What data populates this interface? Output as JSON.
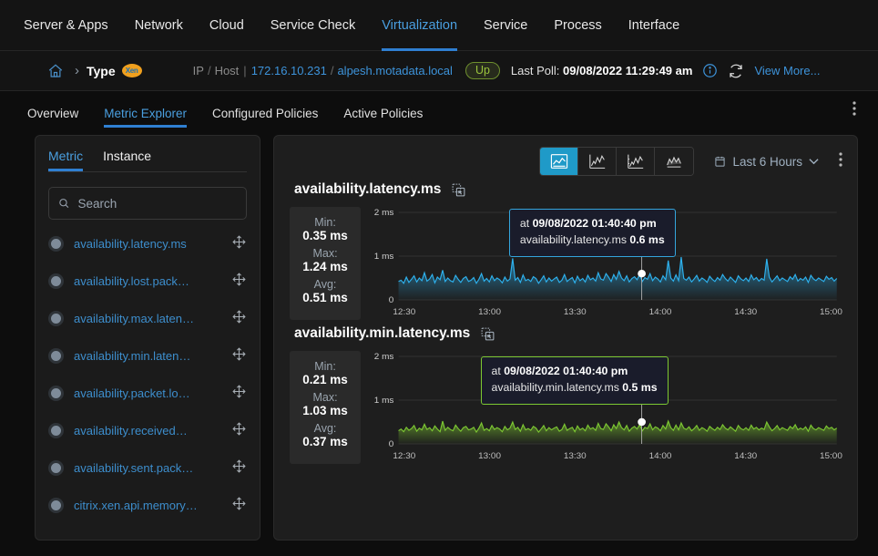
{
  "topnav": {
    "items": [
      {
        "label": "Server & Apps",
        "active": false
      },
      {
        "label": "Network",
        "active": false
      },
      {
        "label": "Cloud",
        "active": false
      },
      {
        "label": "Service Check",
        "active": false
      },
      {
        "label": "Virtualization",
        "active": true
      },
      {
        "label": "Service",
        "active": false
      },
      {
        "label": "Process",
        "active": false
      },
      {
        "label": "Interface",
        "active": false
      }
    ]
  },
  "breadcrumb": {
    "home_icon": "home-icon",
    "chevron": "›",
    "type_label": "Type",
    "vendor_logo": "Xen",
    "ip_label": "IP",
    "host_label": "Host",
    "ip_value": "172.16.10.231",
    "host_value": "alpesh.motadata.local",
    "separator": "/",
    "pipe": "|",
    "status": "Up",
    "last_poll_label": "Last Poll:",
    "last_poll_value": "09/08/2022 11:29:49 am",
    "view_more": "View More...",
    "accent_color": "#3d93da",
    "status_color": "#9bc53d"
  },
  "subtabs": {
    "items": [
      {
        "label": "Overview",
        "active": false
      },
      {
        "label": "Metric Explorer",
        "active": true
      },
      {
        "label": "Configured Policies",
        "active": false
      },
      {
        "label": "Active Policies",
        "active": false
      }
    ]
  },
  "sidebar": {
    "tabs": [
      {
        "label": "Metric",
        "active": true
      },
      {
        "label": "Instance",
        "active": false
      }
    ],
    "search": {
      "placeholder": "Search",
      "value": ""
    },
    "metrics": [
      {
        "label": "availability.latency.ms"
      },
      {
        "label": "availability.lost.pack…"
      },
      {
        "label": "availability.max.laten…"
      },
      {
        "label": "availability.min.laten…"
      },
      {
        "label": "availability.packet.lo…"
      },
      {
        "label": "availability.received…"
      },
      {
        "label": "availability.sent.pack…"
      },
      {
        "label": "citrix.xen.api.memory…"
      }
    ]
  },
  "toolbar": {
    "view_buttons": [
      {
        "icon": "area-chart-icon",
        "active": true
      },
      {
        "icon": "line-chart-icon",
        "active": false
      },
      {
        "icon": "line-chart-scale-icon",
        "active": false
      },
      {
        "icon": "stacked-area-chart-icon",
        "active": false
      }
    ],
    "time_range": "Last 6 Hours",
    "calendar_icon": "calendar-icon",
    "chevron_icon": "chevron-down-icon",
    "kebab_icon": "kebab-menu-icon"
  },
  "charts": [
    {
      "title": "availability.latency.ms",
      "copy_icon": "copy-icon",
      "stats": [
        {
          "label": "Min:",
          "value": "0.35 ms"
        },
        {
          "label": "Max:",
          "value": "1.24 ms"
        },
        {
          "label": "Avg:",
          "value": "0.51 ms"
        }
      ],
      "tooltip": {
        "prefix": "at",
        "timestamp": "09/08/2022 01:40:40 pm",
        "metric": "availability.latency.ms",
        "value": "0.6 ms"
      }
    },
    {
      "title": "availability.min.latency.ms",
      "copy_icon": "copy-icon",
      "stats": [
        {
          "label": "Min:",
          "value": "0.21 ms"
        },
        {
          "label": "Max:",
          "value": "1.03 ms"
        },
        {
          "label": "Avg:",
          "value": "0.37 ms"
        }
      ],
      "tooltip": {
        "prefix": "at",
        "timestamp": "09/08/2022 01:40:40 pm",
        "metric": "availability.min.latency.ms",
        "value": "0.5 ms"
      }
    }
  ],
  "chart_data": [
    {
      "type": "area",
      "title": "availability.latency.ms",
      "xlabel": "",
      "ylabel": "",
      "ylim": [
        0,
        2
      ],
      "yticks": [
        "0",
        "1 ms",
        "2 ms"
      ],
      "xticks": [
        "12:30",
        "13:00",
        "13:30",
        "14:00",
        "14:30",
        "15:00"
      ],
      "grid": true,
      "color": "#2eb3f0",
      "unit": "ms",
      "highlight": {
        "x": "13:40",
        "y": 0.6,
        "label": "09/08/2022 01:40:40 pm"
      },
      "stats": {
        "min": 0.35,
        "max": 1.24,
        "avg": 0.51
      },
      "values": [
        0.42,
        0.45,
        0.38,
        0.52,
        0.4,
        0.47,
        0.55,
        0.41,
        0.5,
        0.44,
        0.62,
        0.43,
        0.48,
        0.58,
        0.39,
        0.52,
        0.46,
        0.68,
        0.42,
        0.5,
        0.44,
        0.41,
        0.56,
        0.47,
        0.4,
        0.49,
        0.53,
        0.42,
        0.45,
        0.51,
        0.38,
        0.47,
        0.6,
        0.43,
        0.49,
        0.41,
        0.55,
        0.44,
        0.5,
        0.46,
        0.39,
        0.52,
        0.43,
        0.48,
        0.95,
        0.45,
        0.51,
        0.4,
        0.57,
        0.44,
        0.47,
        0.42,
        0.53,
        0.49,
        0.38,
        0.46,
        0.55,
        0.41,
        0.5,
        0.43,
        0.48,
        0.52,
        0.4,
        0.45,
        0.58,
        0.42,
        0.47,
        0.51,
        0.39,
        0.54,
        0.44,
        0.49,
        0.41,
        0.56,
        0.46,
        0.5,
        0.43,
        0.62,
        0.48,
        0.45,
        0.6,
        0.52,
        0.42,
        0.58,
        0.47,
        0.65,
        0.5,
        0.44,
        0.55,
        0.41,
        0.49,
        0.53,
        0.46,
        0.58,
        0.42,
        0.51,
        0.47,
        0.6,
        0.44,
        0.52,
        0.48,
        0.41,
        0.55,
        0.46,
        0.9,
        0.5,
        0.43,
        0.57,
        0.44,
        0.98,
        0.49,
        0.45,
        0.52,
        0.41,
        0.48,
        0.56,
        0.43,
        0.5,
        0.46,
        0.4,
        0.54,
        0.47,
        0.42,
        0.51,
        0.45,
        0.58,
        0.49,
        0.43,
        0.52,
        0.46,
        0.4,
        0.55,
        0.48,
        0.44,
        0.5,
        0.42,
        0.57,
        0.46,
        0.51,
        0.43,
        0.49,
        0.45,
        0.94,
        0.52,
        0.41,
        0.48,
        0.55,
        0.44,
        0.5,
        0.46,
        0.42,
        0.53,
        0.47,
        0.58,
        0.43,
        0.49,
        0.45,
        0.52,
        0.4,
        0.56,
        0.48,
        0.44,
        0.5,
        0.46,
        0.42,
        0.54,
        0.47,
        0.51,
        0.43,
        0.49
      ]
    },
    {
      "type": "area",
      "title": "availability.min.latency.ms",
      "xlabel": "",
      "ylabel": "",
      "ylim": [
        0,
        2
      ],
      "yticks": [
        "0",
        "1 ms",
        "2 ms"
      ],
      "xticks": [
        "12:30",
        "13:00",
        "13:30",
        "14:00",
        "14:30",
        "15:00"
      ],
      "grid": true,
      "color": "#7dc832",
      "unit": "ms",
      "highlight": {
        "x": "13:40",
        "y": 0.5,
        "label": "09/08/2022 01:40:40 pm"
      },
      "stats": {
        "min": 0.21,
        "max": 1.03,
        "avg": 0.37
      },
      "values": [
        0.3,
        0.34,
        0.28,
        0.38,
        0.31,
        0.35,
        0.42,
        0.29,
        0.36,
        0.32,
        0.45,
        0.33,
        0.37,
        0.3,
        0.41,
        0.34,
        0.28,
        0.52,
        0.31,
        0.38,
        0.33,
        0.3,
        0.43,
        0.35,
        0.29,
        0.37,
        0.4,
        0.32,
        0.34,
        0.38,
        0.27,
        0.36,
        0.48,
        0.31,
        0.35,
        0.3,
        0.42,
        0.33,
        0.37,
        0.34,
        0.28,
        0.4,
        0.32,
        0.36,
        0.5,
        0.33,
        0.38,
        0.29,
        0.44,
        0.32,
        0.35,
        0.31,
        0.4,
        0.36,
        0.27,
        0.34,
        0.42,
        0.3,
        0.37,
        0.32,
        0.36,
        0.39,
        0.29,
        0.33,
        0.45,
        0.31,
        0.35,
        0.38,
        0.28,
        0.41,
        0.32,
        0.36,
        0.3,
        0.43,
        0.34,
        0.37,
        0.31,
        0.47,
        0.35,
        0.33,
        0.46,
        0.39,
        0.3,
        0.44,
        0.35,
        0.5,
        0.37,
        0.32,
        0.42,
        0.29,
        0.36,
        0.4,
        0.34,
        0.44,
        0.3,
        0.38,
        0.35,
        0.46,
        0.32,
        0.39,
        0.36,
        0.3,
        0.42,
        0.34,
        0.52,
        0.37,
        0.31,
        0.43,
        0.32,
        0.48,
        0.36,
        0.33,
        0.39,
        0.3,
        0.35,
        0.42,
        0.31,
        0.37,
        0.34,
        0.29,
        0.4,
        0.35,
        0.31,
        0.38,
        0.33,
        0.44,
        0.36,
        0.32,
        0.39,
        0.34,
        0.29,
        0.42,
        0.35,
        0.32,
        0.37,
        0.31,
        0.43,
        0.34,
        0.38,
        0.32,
        0.36,
        0.33,
        0.5,
        0.39,
        0.3,
        0.35,
        0.42,
        0.32,
        0.37,
        0.34,
        0.31,
        0.4,
        0.35,
        0.44,
        0.32,
        0.36,
        0.33,
        0.39,
        0.29,
        0.43,
        0.35,
        0.32,
        0.37,
        0.34,
        0.31,
        0.41,
        0.35,
        0.38,
        0.32,
        0.36
      ]
    }
  ]
}
